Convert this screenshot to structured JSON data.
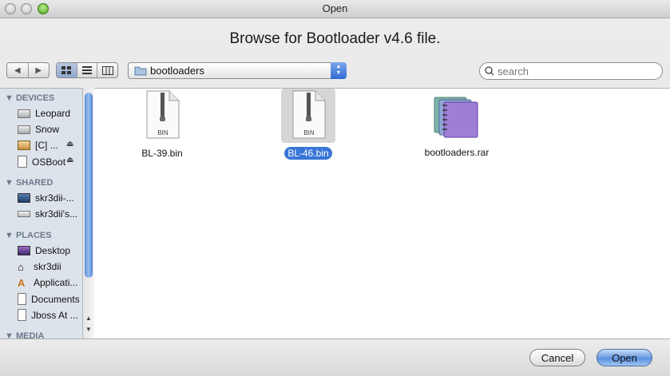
{
  "window": {
    "title": "Open"
  },
  "dialog": {
    "prompt": "Browse for Bootloader v4.6 file."
  },
  "toolbar": {
    "back_icon": "triangle-left-icon",
    "forward_icon": "triangle-right-icon",
    "view_modes": [
      "icon-view",
      "list-view",
      "column-view"
    ],
    "active_view": "icon-view",
    "location": "bootloaders",
    "search_placeholder": "search"
  },
  "sidebar": {
    "devices_label": "DEVICES",
    "devices": [
      "Leopard",
      "Snow",
      "[C] ...",
      "OSBoot"
    ],
    "shared_label": "SHARED",
    "shared": [
      "skr3dii-...",
      "skr3dii's..."
    ],
    "places_label": "PLACES",
    "places": [
      "Desktop",
      "skr3dii",
      "Applicati...",
      "Documents",
      "Jboss At ..."
    ],
    "media_label": "MEDIA"
  },
  "files": [
    {
      "name": "BL-39.bin",
      "badge": "BIN",
      "selected": false
    },
    {
      "name": "BL-46.bin",
      "badge": "BIN",
      "selected": true
    },
    {
      "name": "bootloaders.rar",
      "badge": "",
      "selected": false
    }
  ],
  "buttons": {
    "cancel": "Cancel",
    "open": "Open"
  },
  "colors": {
    "selection": "#3875d7",
    "sidebar_bg": "#dde3ea",
    "accent": "#5a8fdf"
  }
}
